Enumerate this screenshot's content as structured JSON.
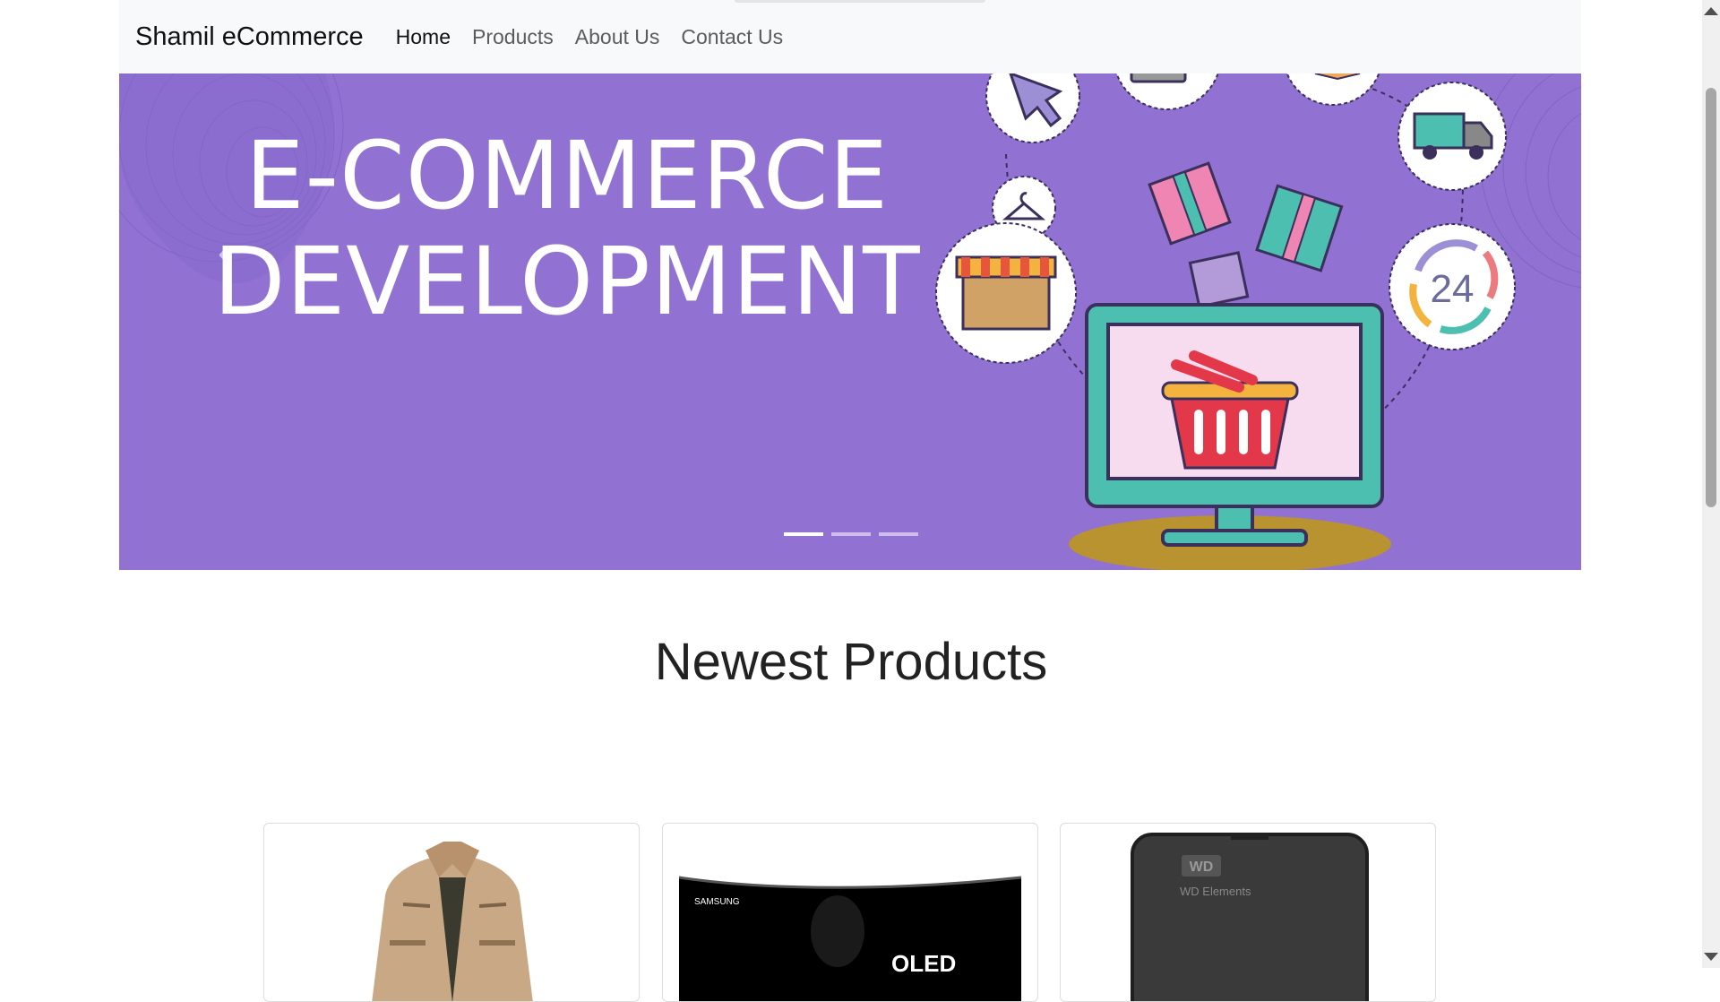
{
  "navbar": {
    "brand": "Shamil eCommerce",
    "links": [
      {
        "label": "Home",
        "active": true
      },
      {
        "label": "Products",
        "active": false
      },
      {
        "label": "About Us",
        "active": false
      },
      {
        "label": "Contact Us",
        "active": false
      }
    ]
  },
  "hero": {
    "title_line1": "E-COMMERCE",
    "title_line2": "DEVELOPMENT",
    "clock_label": "24",
    "background_color": "#9172d3",
    "slides_count": 3,
    "active_slide": 1,
    "prev_icon": "chevron-left-icon"
  },
  "newest": {
    "title": "Newest Products",
    "products": [
      {
        "image": "jacket-image"
      },
      {
        "image": "oled-tv-image",
        "brand_text": "SAMSUNG",
        "screen_text": "OLED"
      },
      {
        "image": "hard-drive-image",
        "logo_text": "WD",
        "label_text": "WD Elements"
      }
    ]
  }
}
